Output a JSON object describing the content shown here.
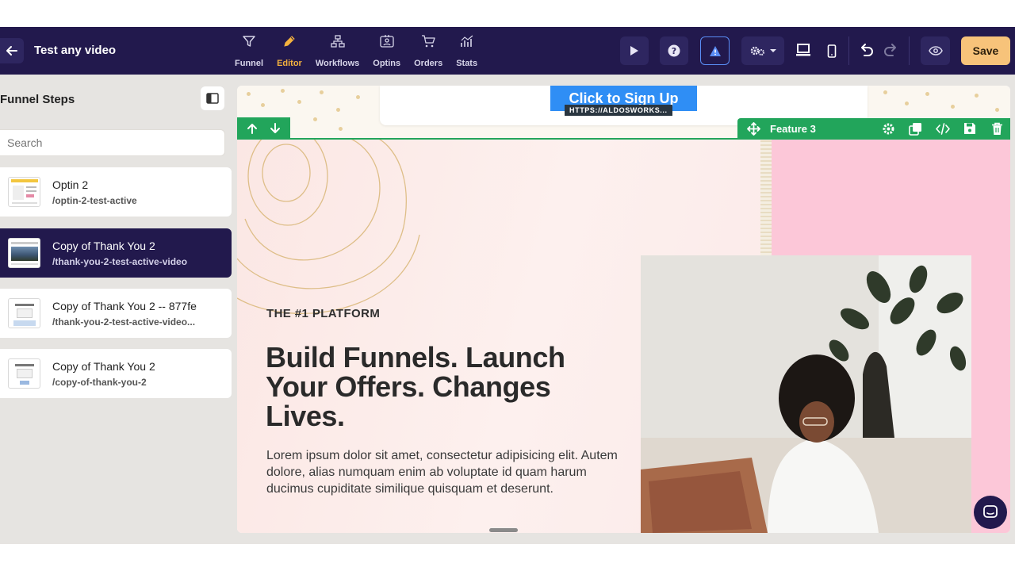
{
  "header": {
    "title": "Test any video",
    "nav": [
      {
        "label": "Funnel",
        "icon": "filter-icon"
      },
      {
        "label": "Editor",
        "icon": "pencil-icon",
        "active": true
      },
      {
        "label": "Workflows",
        "icon": "workflow-icon"
      },
      {
        "label": "Optins",
        "icon": "contact-card-icon"
      },
      {
        "label": "Orders",
        "icon": "cart-icon"
      },
      {
        "label": "Stats",
        "icon": "stats-icon"
      }
    ],
    "save_label": "Save",
    "accent": "#f4b23e",
    "bg": "#22194d"
  },
  "sidebar": {
    "title": "Funnel Steps",
    "search_placeholder": "Search",
    "steps": [
      {
        "name": "Optin 2",
        "slug": "/optin-2-test-active"
      },
      {
        "name": "Copy of Thank You 2",
        "slug": "/thank-you-2-test-active-video",
        "active": true
      },
      {
        "name": "Copy of Thank You 2 -- 877fe",
        "slug": "/thank-you-2-test-active-video..."
      },
      {
        "name": "Copy of Thank You 2",
        "slug": "/copy-of-thank-you-2"
      }
    ]
  },
  "canvas": {
    "cta_label": "Click to Sign Up",
    "cta_url": "HTTPS://ALDOSWORKS...",
    "section_label": "Feature 3",
    "eyebrow": "THE #1 PLATFORM",
    "headline": "Build Funnels. Launch Your Offers. Changes Lives.",
    "body": "Lorem ipsum dolor sit amet, consectetur adipisicing elit. Autem dolore, alias numquam enim ab voluptate id quam harum ducimus cupiditate similique quisquam et deserunt.",
    "section_color": "#22a55b",
    "cta_color": "#2f8ef5",
    "hero_pink": "#fcc7d8"
  }
}
